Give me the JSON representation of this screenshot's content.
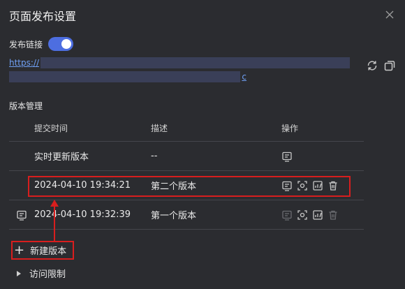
{
  "dialog": {
    "title": "页面发布设置"
  },
  "publish": {
    "label": "发布链接",
    "enabled": true,
    "link_start": "https://",
    "link_end": "c"
  },
  "versions": {
    "section_title": "版本管理",
    "columns": [
      "提交时间",
      "描述",
      "操作"
    ],
    "rows": [
      {
        "time": "实时更新版本",
        "desc": "--"
      },
      {
        "time": "2024-04-10 19:34:21",
        "desc": "第二个版本"
      },
      {
        "time": "2024-04-10 19:32:39",
        "desc": "第一个版本"
      }
    ]
  },
  "actions": {
    "new_version": "新建版本",
    "access_limit": "访问限制"
  },
  "colors": {
    "accent": "#4d6ee0",
    "highlight": "#d81e1e",
    "link": "#6fa0f5"
  }
}
